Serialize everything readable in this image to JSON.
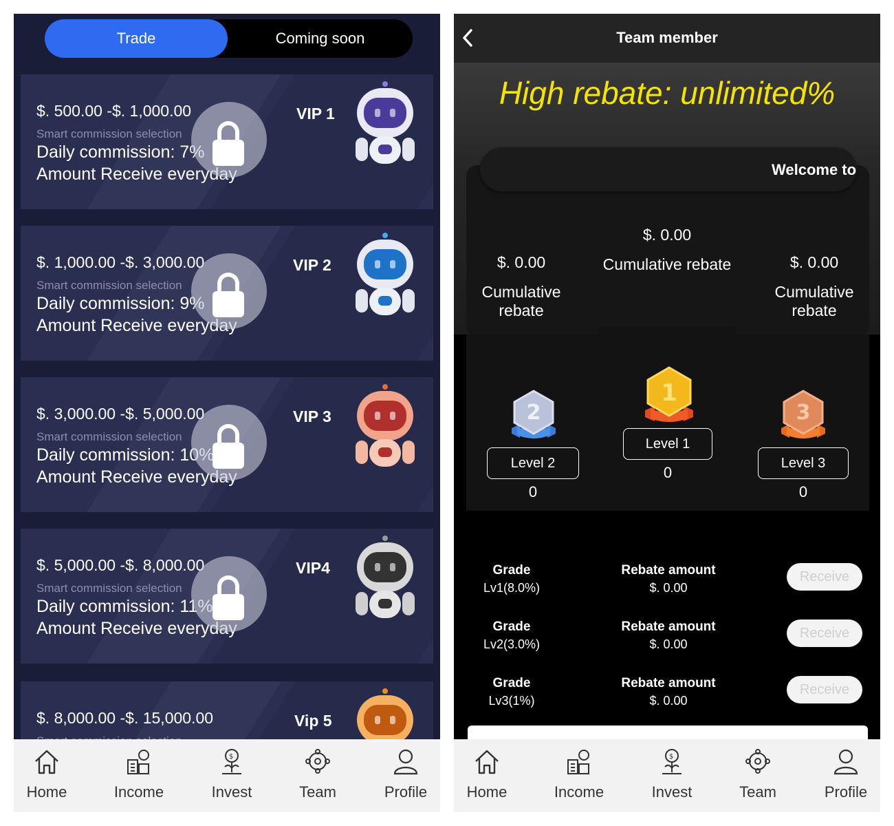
{
  "left": {
    "tabs": {
      "trade": "Trade",
      "coming_soon": "Coming soon"
    },
    "cards": [
      {
        "range": "$. 500.00 -$. 1,000.00",
        "smart": "Smart commission selection",
        "daily": "Daily commission: 7%",
        "amount": "Amount Receive everyday",
        "vip": "VIP 1",
        "badge": "crown",
        "color": "#4a3a9a"
      },
      {
        "range": "$. 1,000.00 -$. 3,000.00",
        "smart": "Smart commission selection",
        "daily": "Daily commission: 9%",
        "amount": "Amount Receive everyday",
        "vip": "VIP 2",
        "badge": "diamond",
        "color": "#1e73c8"
      },
      {
        "range": "$. 3,000.00 -$. 5,000.00",
        "smart": "Smart commission selection",
        "daily": "Daily commission: 10%",
        "amount": "Amount Receive everyday",
        "vip": "VIP 3",
        "badge": "bronze",
        "color": "#b0302e"
      },
      {
        "range": "$. 5,000.00 -$. 8,000.00",
        "smart": "Smart commission selection",
        "daily": "Daily commission: 11%",
        "amount": "Amount Receive everyday",
        "vip": "VIP4",
        "badge": "silver",
        "color": "#333333"
      },
      {
        "range": "$. 8,000.00 -$. 15,000.00",
        "smart": "Smart commission selection",
        "vip": "Vip 5",
        "badge": "gold",
        "color": "#c05a10"
      }
    ]
  },
  "tabbar": {
    "home": "Home",
    "income": "Income",
    "invest": "Invest",
    "team": "Team",
    "profile": "Profile"
  },
  "right": {
    "title": "Team member",
    "slogan": "High rebate: unlimited%",
    "marquee": "Welcome to",
    "stats": [
      {
        "value": "$. 0.00",
        "label": "Cumulative rebate"
      },
      {
        "value": "$. 0.00",
        "label": "Cumulative rebate"
      },
      {
        "value": "$. 0.00",
        "label": "Cumulative rebate"
      }
    ],
    "levels": [
      {
        "label": "Level 2",
        "count": "0"
      },
      {
        "label": "Level 1",
        "count": "0"
      },
      {
        "label": "Level 3",
        "count": "0"
      }
    ],
    "grades": [
      {
        "grade": "Grade",
        "level": "Lv1(8.0%)",
        "rebate": "Rebate amount",
        "amount": "$. 0.00",
        "button": "Receive"
      },
      {
        "grade": "Grade",
        "level": "Lv2(3.0%)",
        "rebate": "Rebate amount",
        "amount": "$. 0.00",
        "button": "Receive"
      },
      {
        "grade": "Grade",
        "level": "Lv3(1%)",
        "rebate": "Rebate amount",
        "amount": "$. 0.00",
        "button": "Receive"
      }
    ]
  },
  "colors": {
    "accent": "#2f6bf0",
    "slogan": "#f5e400",
    "medal_gold": "#f2b81c",
    "medal_silver": "#b9c2d8",
    "medal_bronze": "#e08a5c"
  }
}
